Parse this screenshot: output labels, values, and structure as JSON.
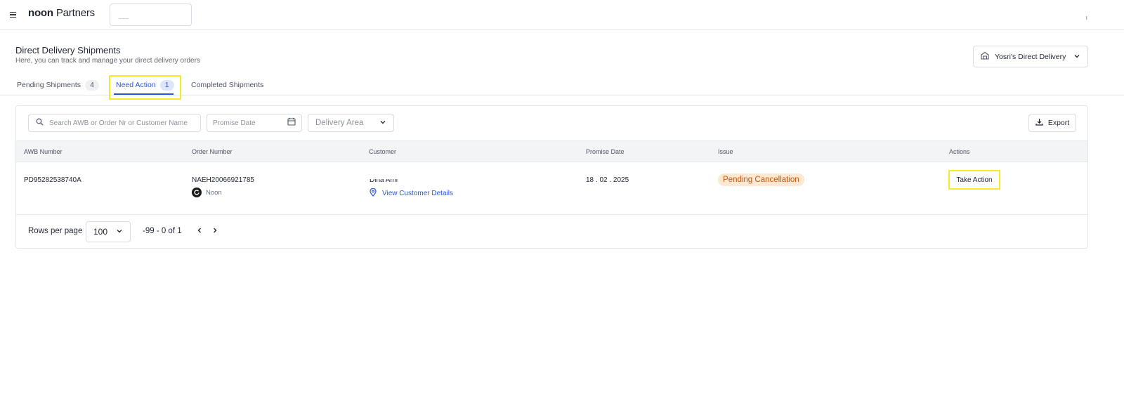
{
  "topbar": {
    "logo_bold": "noon",
    "logo_light": "Partners",
    "corner_mark": "ı"
  },
  "header": {
    "title": "Direct Delivery Shipments",
    "subtitle": "Here, you can track and manage your direct delivery orders",
    "delivery_account": "Yosri's Direct Delivery"
  },
  "tabs": [
    {
      "label": "Pending Shipments",
      "count": "4"
    },
    {
      "label": "Need Action",
      "count": "1",
      "active": true
    },
    {
      "label": "Completed Shipments"
    }
  ],
  "filters": {
    "search_placeholder": "Search AWB or Order Nr or Customer Name",
    "date_placeholder": "Promise Date",
    "area_placeholder": "Delivery Area",
    "export_label": "Export"
  },
  "table": {
    "columns": [
      "AWB Number",
      "Order Number",
      "Customer",
      "Promise Date",
      "Issue",
      "Actions"
    ],
    "rows": [
      {
        "awb": "PD95282538740A",
        "order_number": "NAEH20066921785",
        "marketplace": "Noon",
        "customer_name": "Dina Amr",
        "customer_link": "View Customer Details",
        "promise_date": "18 . 02 . 2025",
        "issue": "Pending Cancellation",
        "action": "Take Action"
      }
    ]
  },
  "pagination": {
    "rows_per_page_label": "Rows per page",
    "rows_per_page": "100",
    "range": "-99 - 0 of 1"
  },
  "colors": {
    "accent": "#2a56d6",
    "highlight": "#f5ea2a",
    "issue_bg": "#fde8d3",
    "issue_text": "#c2560f"
  }
}
